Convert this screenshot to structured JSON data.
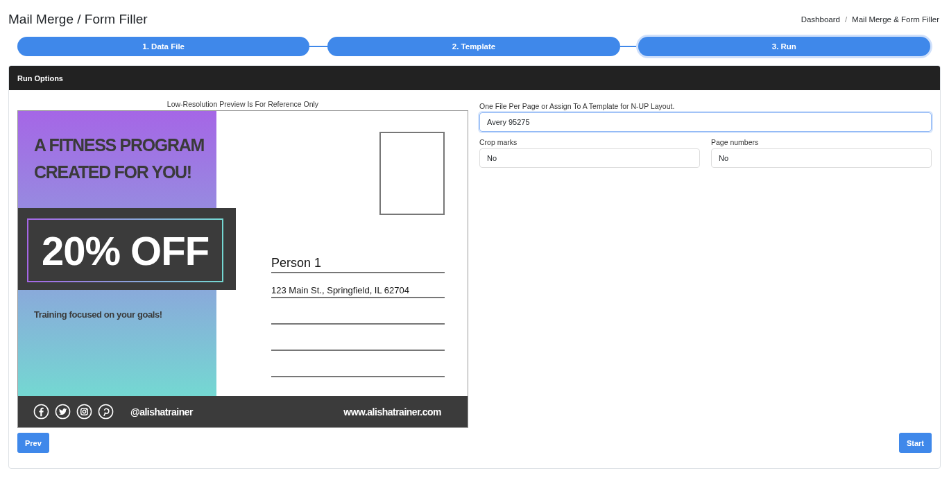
{
  "page_title": "Mail Merge / Form Filler",
  "breadcrumb": [
    "Dashboard",
    "Mail Merge & Form Filler"
  ],
  "breadcrumb_separator": "/",
  "steps": [
    {
      "label": "1. Data File",
      "selected": false
    },
    {
      "label": "2. Template",
      "selected": false
    },
    {
      "label": "3. Run",
      "selected": true
    }
  ],
  "card": {
    "title": "Run Options"
  },
  "preview": {
    "caption": "Low-Resolution Preview Is For Reference Only",
    "headline": [
      "A FITNESS PROGRAM",
      "CREATED FOR YOU!"
    ],
    "offer": "20% OFF",
    "tagline": "Training focused on your goals!",
    "recipient_lines": [
      "Person 1",
      "123 Main St., Springfield, IL 62704"
    ],
    "handle": "@alishatrainer",
    "website": "www.alishatrainer.com"
  },
  "layout_field": {
    "label": "One File Per Page or Assign To A Template for N-UP Layout.",
    "value": "Avery 95275",
    "focused": true
  },
  "options": [
    {
      "label": "Crop marks",
      "value": "No"
    },
    {
      "label": "Page numbers",
      "value": "No"
    }
  ],
  "buttons": {
    "prev": "Prev",
    "start": "Start"
  }
}
